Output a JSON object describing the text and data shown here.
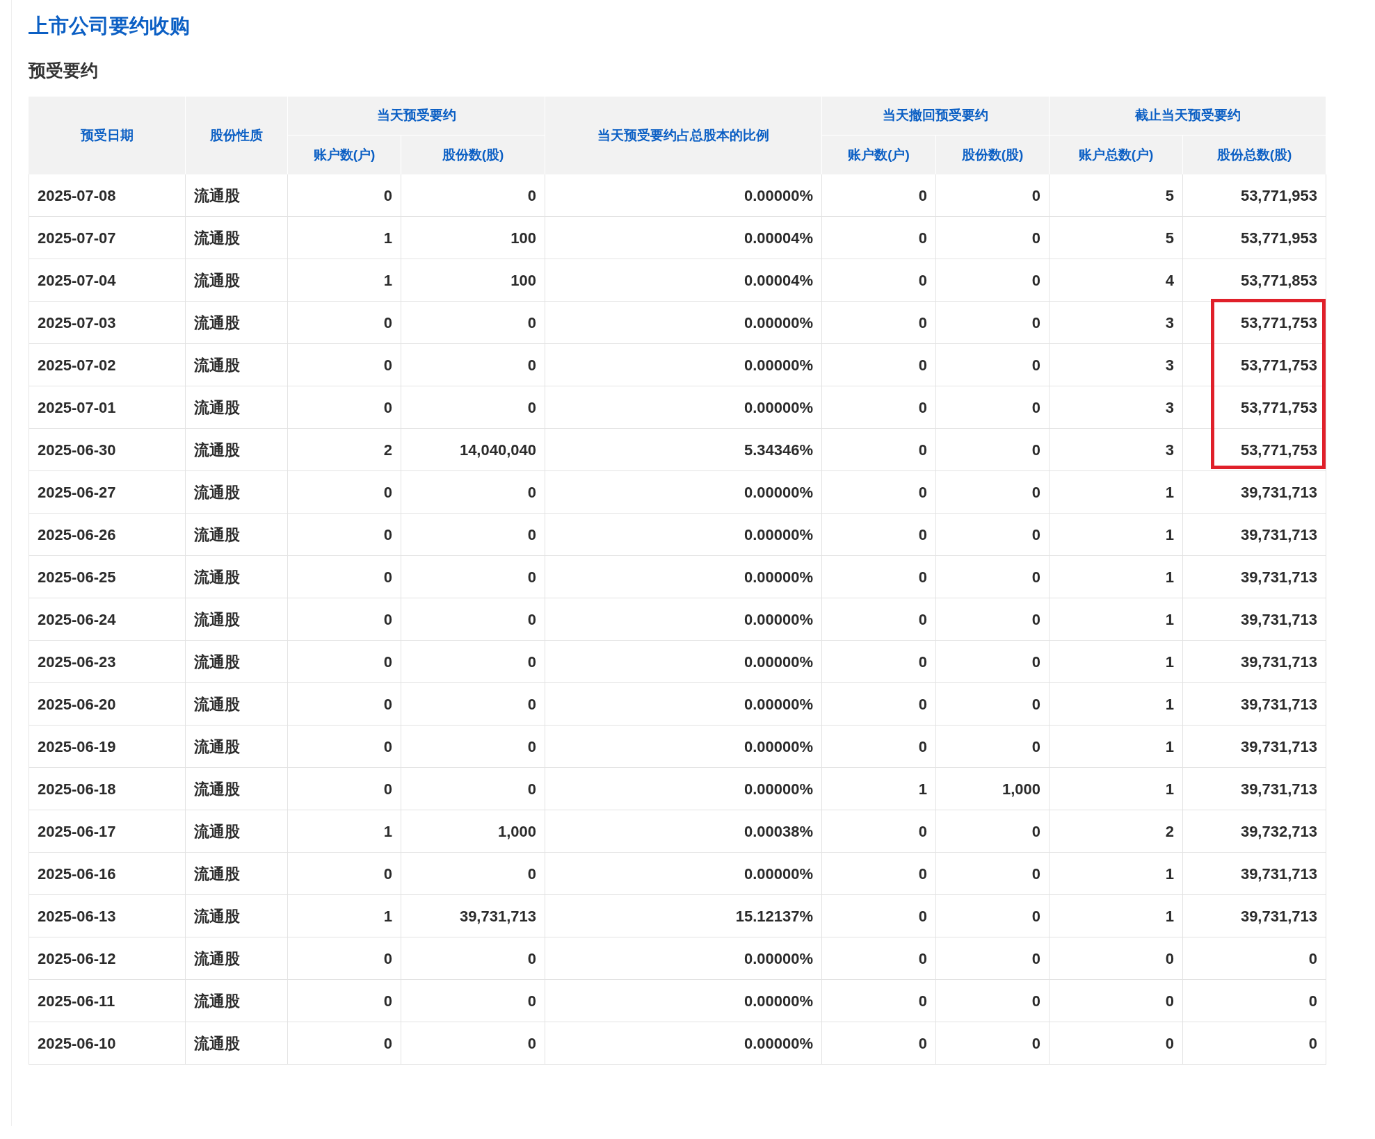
{
  "title": "上市公司要约收购",
  "section_title": "预受要约",
  "table": {
    "header_rows": [
      [
        {
          "label": "预受日期",
          "rowspan": 2
        },
        {
          "label": "股份性质",
          "rowspan": 2
        },
        {
          "label": "当天预受要约",
          "colspan": 2
        },
        {
          "label": "当天预受要约占总股本的比例",
          "rowspan": 2
        },
        {
          "label": "当天撤回预受要约",
          "colspan": 2
        },
        {
          "label": "截止当天预受要约",
          "colspan": 2
        }
      ],
      [
        {
          "label": "账户数(户)"
        },
        {
          "label": "股份数(股)"
        },
        {
          "label": "账户数(户)"
        },
        {
          "label": "股份数(股)"
        },
        {
          "label": "账户总数(户)"
        },
        {
          "label": "股份总数(股)"
        }
      ]
    ],
    "rows": [
      {
        "cells": [
          "2025-07-08",
          "流通股",
          "0",
          "0",
          "0.00000%",
          "0",
          "0",
          "5",
          "53,771,953"
        ],
        "highlighted": false
      },
      {
        "cells": [
          "2025-07-07",
          "流通股",
          "1",
          "100",
          "0.00004%",
          "0",
          "0",
          "5",
          "53,771,953"
        ],
        "highlighted": false
      },
      {
        "cells": [
          "2025-07-04",
          "流通股",
          "1",
          "100",
          "0.00004%",
          "0",
          "0",
          "4",
          "53,771,853"
        ],
        "highlighted": false
      },
      {
        "cells": [
          "2025-07-03",
          "流通股",
          "0",
          "0",
          "0.00000%",
          "0",
          "0",
          "3",
          "53,771,753"
        ],
        "highlighted": true
      },
      {
        "cells": [
          "2025-07-02",
          "流通股",
          "0",
          "0",
          "0.00000%",
          "0",
          "0",
          "3",
          "53,771,753"
        ],
        "highlighted": true
      },
      {
        "cells": [
          "2025-07-01",
          "流通股",
          "0",
          "0",
          "0.00000%",
          "0",
          "0",
          "3",
          "53,771,753"
        ],
        "highlighted": true
      },
      {
        "cells": [
          "2025-06-30",
          "流通股",
          "2",
          "14,040,040",
          "5.34346%",
          "0",
          "0",
          "3",
          "53,771,753"
        ],
        "highlighted": true
      },
      {
        "cells": [
          "2025-06-27",
          "流通股",
          "0",
          "0",
          "0.00000%",
          "0",
          "0",
          "1",
          "39,731,713"
        ],
        "highlighted": false
      },
      {
        "cells": [
          "2025-06-26",
          "流通股",
          "0",
          "0",
          "0.00000%",
          "0",
          "0",
          "1",
          "39,731,713"
        ],
        "highlighted": false
      },
      {
        "cells": [
          "2025-06-25",
          "流通股",
          "0",
          "0",
          "0.00000%",
          "0",
          "0",
          "1",
          "39,731,713"
        ],
        "highlighted": false
      },
      {
        "cells": [
          "2025-06-24",
          "流通股",
          "0",
          "0",
          "0.00000%",
          "0",
          "0",
          "1",
          "39,731,713"
        ],
        "highlighted": false
      },
      {
        "cells": [
          "2025-06-23",
          "流通股",
          "0",
          "0",
          "0.00000%",
          "0",
          "0",
          "1",
          "39,731,713"
        ],
        "highlighted": false
      },
      {
        "cells": [
          "2025-06-20",
          "流通股",
          "0",
          "0",
          "0.00000%",
          "0",
          "0",
          "1",
          "39,731,713"
        ],
        "highlighted": false
      },
      {
        "cells": [
          "2025-06-19",
          "流通股",
          "0",
          "0",
          "0.00000%",
          "0",
          "0",
          "1",
          "39,731,713"
        ],
        "highlighted": false
      },
      {
        "cells": [
          "2025-06-18",
          "流通股",
          "0",
          "0",
          "0.00000%",
          "1",
          "1,000",
          "1",
          "39,731,713"
        ],
        "highlighted": false
      },
      {
        "cells": [
          "2025-06-17",
          "流通股",
          "1",
          "1,000",
          "0.00038%",
          "0",
          "0",
          "2",
          "39,732,713"
        ],
        "highlighted": false
      },
      {
        "cells": [
          "2025-06-16",
          "流通股",
          "0",
          "0",
          "0.00000%",
          "0",
          "0",
          "1",
          "39,731,713"
        ],
        "highlighted": false
      },
      {
        "cells": [
          "2025-06-13",
          "流通股",
          "1",
          "39,731,713",
          "15.12137%",
          "0",
          "0",
          "1",
          "39,731,713"
        ],
        "highlighted": false
      },
      {
        "cells": [
          "2025-06-12",
          "流通股",
          "0",
          "0",
          "0.00000%",
          "0",
          "0",
          "0",
          "0"
        ],
        "highlighted": false
      },
      {
        "cells": [
          "2025-06-11",
          "流通股",
          "0",
          "0",
          "0.00000%",
          "0",
          "0",
          "0",
          "0"
        ],
        "highlighted": false
      },
      {
        "cells": [
          "2025-06-10",
          "流通股",
          "0",
          "0",
          "0.00000%",
          "0",
          "0",
          "0",
          "0"
        ],
        "highlighted": false
      }
    ]
  }
}
